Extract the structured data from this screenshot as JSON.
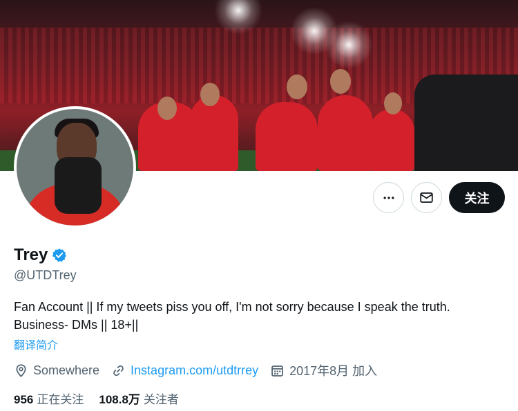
{
  "profile": {
    "display_name": "Trey",
    "handle": "@UTDTrey",
    "bio_line1": "Fan Account || If my tweets piss you off, I'm not sorry because I speak the truth.",
    "bio_line2": "Business- DMs || 18+||",
    "translate_label": "翻译简介",
    "location": "Somewhere",
    "link": "Instagram.com/utdtrrey",
    "joined": "2017年8月 加入"
  },
  "actions": {
    "follow_label": "关注"
  },
  "stats": {
    "following_count": "956",
    "following_label": "正在关注",
    "followers_count": "108.8万",
    "followers_label": "关注者"
  },
  "icons": {
    "more": "more-icon",
    "message": "mail-icon",
    "verified": "verified-badge-icon",
    "location": "location-pin-icon",
    "link": "link-icon",
    "calendar": "calendar-icon"
  },
  "colors": {
    "accent": "#1d9bf0",
    "text_primary": "#0f1419",
    "text_secondary": "#536471",
    "follow_button": "#0f1419"
  }
}
